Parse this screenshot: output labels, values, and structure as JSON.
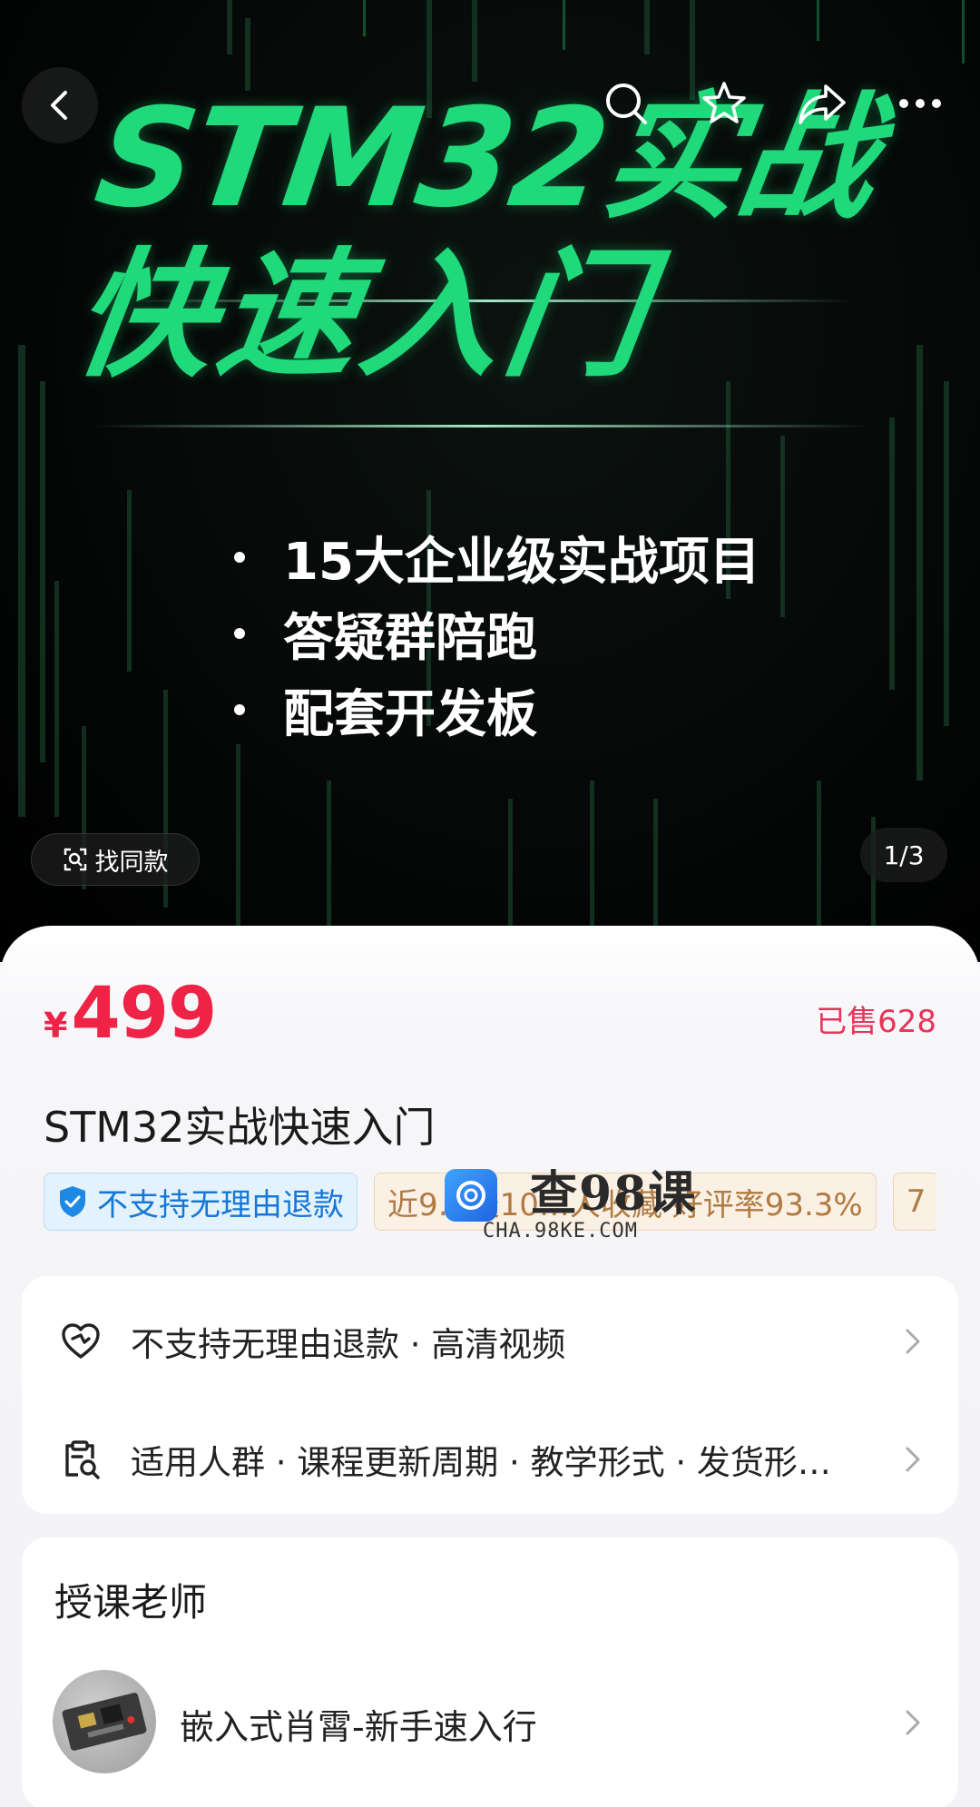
{
  "hero": {
    "title_line1": "STM32实战",
    "title_line2": "快速入门",
    "bullets": [
      "15大企业级实战项目",
      "答疑群陪跑",
      "配套开发板"
    ],
    "accent_color": "#1fd97a",
    "find_same_label": "找同款",
    "page_indicator": "1/3"
  },
  "toolbar": {
    "back_icon": "back-icon",
    "search_icon": "search-icon",
    "favorite_icon": "star-icon",
    "share_icon": "share-icon",
    "more_icon": "more-icon"
  },
  "product": {
    "currency": "¥",
    "price": "499",
    "sold": "已售628",
    "title": "STM32实战快速入门",
    "price_color": "#ee2346",
    "tags": [
      {
        "label": "不支持无理由退款",
        "style": "blue",
        "icon": "shield-check-icon"
      },
      {
        "label": "近9…天10…人收藏 好评率93.3%",
        "style": "tan"
      },
      {
        "label": "7",
        "style": "tan"
      }
    ]
  },
  "watermark": {
    "main": "查98课",
    "sub": "CHA.98KE.COM"
  },
  "service_card": {
    "rows": [
      {
        "icon": "heart-shield-icon",
        "text": "不支持无理由退款 · 高清视频"
      },
      {
        "icon": "clipboard-search-icon",
        "text": "适用人群 · 课程更新周期 · 教学形式 · 发货形…"
      }
    ]
  },
  "teacher": {
    "heading": "授课老师",
    "name": "嵌入式肖霄-新手速入行"
  }
}
